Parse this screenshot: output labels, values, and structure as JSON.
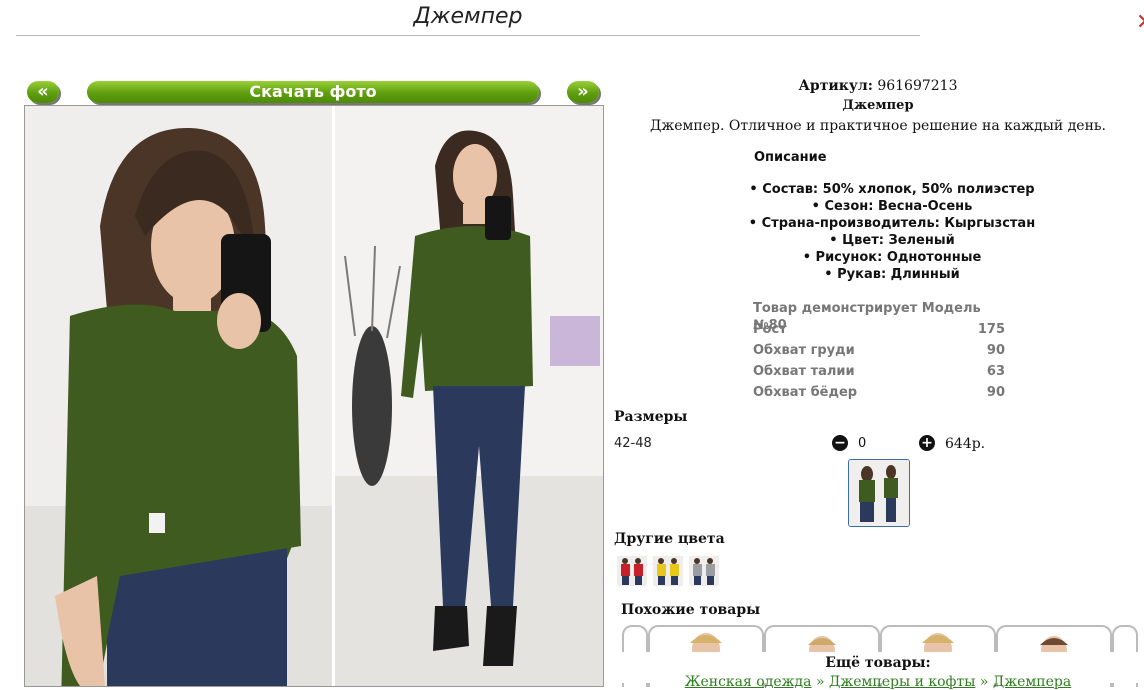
{
  "page": {
    "title": "Джемпер"
  },
  "gallery": {
    "prev_label": "«",
    "download_label": "Скачать фото",
    "next_label": "»"
  },
  "product": {
    "sku_label": "Артикул:",
    "sku_value": "961697213",
    "name": "Джемпер",
    "tagline": "Джемпер. Отличное и практичное решение на каждый день.",
    "description_heading": "Описание",
    "properties": [
      "• Состав: 50% хлопок, 50% полиэстер",
      "• Сезон: Весна-Осень",
      "• Страна-производитель: Кыргызстан",
      "• Цвет: Зеленый",
      "• Рисунок: Однотонные",
      "• Рукав: Длинный"
    ],
    "model": [
      {
        "label": "Товар демонстрирует Модель №80",
        "value": ""
      },
      {
        "label": "Рост",
        "value": "175"
      },
      {
        "label": "Обхват груди",
        "value": "90"
      },
      {
        "label": "Обхват талии",
        "value": "63"
      },
      {
        "label": "Обхват бёдер",
        "value": "90"
      }
    ]
  },
  "sizes": {
    "heading": "Размеры",
    "range": "42-48",
    "minus": "−",
    "quantity": "0",
    "plus": "+",
    "price": "644р."
  },
  "other_colors": {
    "heading": "Другие цвета"
  },
  "similar": {
    "heading": "Похожие товары"
  },
  "more": {
    "label": "Ещё товары:",
    "links": [
      "Женская одежда",
      "Джемперы и кофты",
      "Джемпера"
    ],
    "separator": "»"
  },
  "colors": {
    "accent_green": "#5e9e0e",
    "link_green": "#2e7d1e",
    "sweater_green": "#3f5b1f",
    "jeans": "#2b3a5c"
  }
}
